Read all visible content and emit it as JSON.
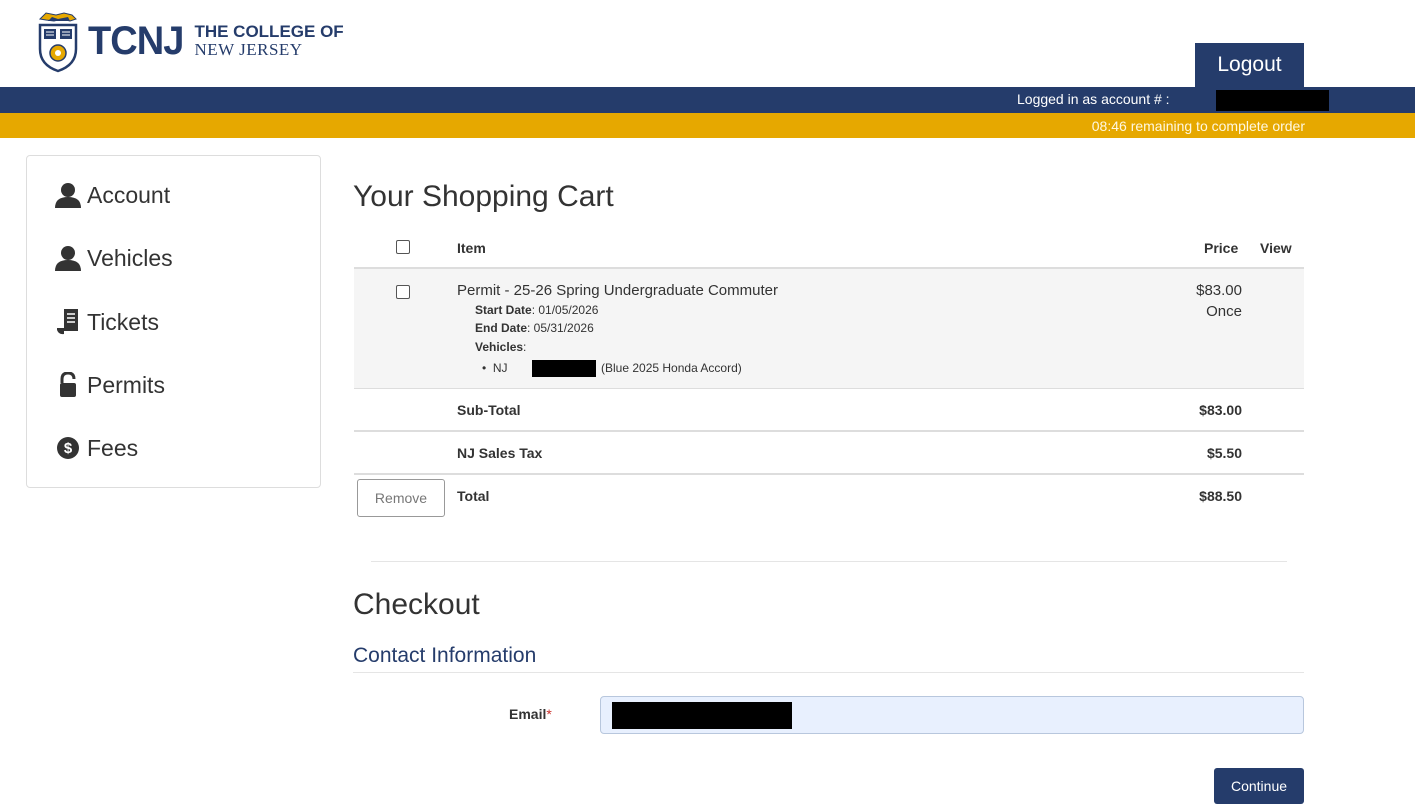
{
  "header": {
    "logo_abbr": "TCNJ",
    "logo_line1": "THE COLLEGE OF",
    "logo_line2": "NEW JERSEY",
    "logout_label": "Logout",
    "logged_in_text": "Logged in as account # :",
    "timer_text": "08:46 remaining to complete order"
  },
  "sidebar": {
    "items": [
      {
        "label": "Account",
        "icon": "person-icon"
      },
      {
        "label": "Vehicles",
        "icon": "person-icon"
      },
      {
        "label": "Tickets",
        "icon": "ticket-icon"
      },
      {
        "label": "Permits",
        "icon": "lock-icon"
      },
      {
        "label": "Fees",
        "icon": "dollar-circle-icon"
      }
    ]
  },
  "cart": {
    "title": "Your Shopping Cart",
    "columns": {
      "item": "Item",
      "price": "Price",
      "view": "View"
    },
    "item": {
      "title": "Permit - 25-26 Spring Undergraduate Commuter",
      "start_label": "Start Date",
      "start_value": ": 01/05/2026",
      "end_label": "End Date",
      "end_value": ": 05/31/2026",
      "vehicles_label": "Vehicles",
      "vehicles_colon": ":",
      "vehicle_state": "NJ",
      "vehicle_desc": "(Blue 2025 Honda Accord)",
      "price": "$83.00",
      "frequency": "Once"
    },
    "subtotal_label": "Sub-Total",
    "subtotal_value": "$83.00",
    "tax_label": "NJ Sales Tax",
    "tax_value": "$5.50",
    "total_label": "Total",
    "total_value": "$88.50",
    "remove_label": "Remove"
  },
  "checkout": {
    "title": "Checkout",
    "contact_title": "Contact Information",
    "email_label": "Email",
    "required_mark": "*",
    "continue_label": "Continue"
  },
  "colors": {
    "navy": "#253c6b",
    "gold": "#e6a800",
    "input_bg": "#e8f0fe"
  }
}
